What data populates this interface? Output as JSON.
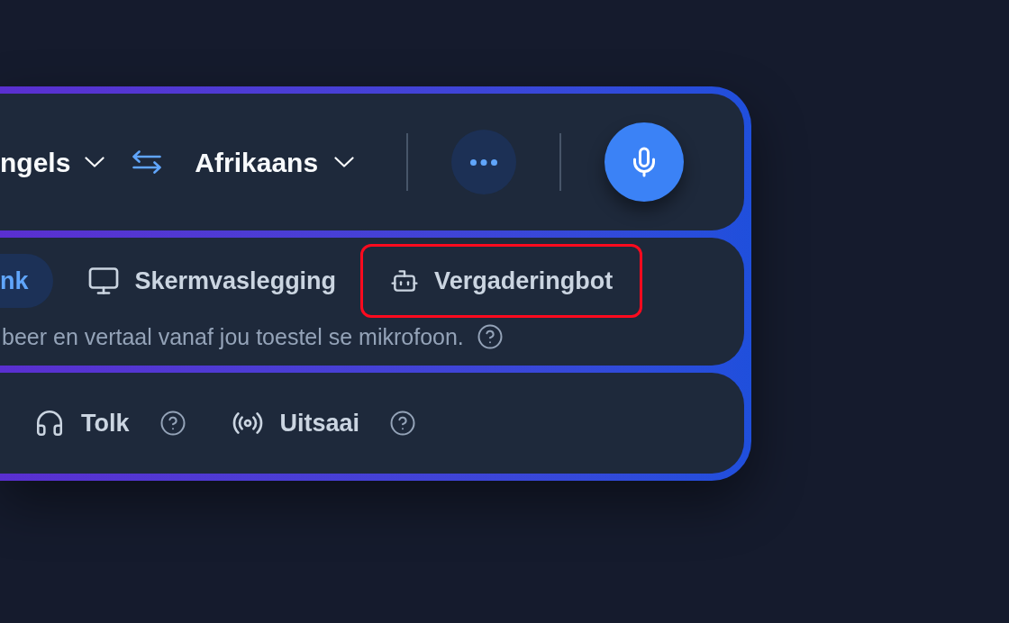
{
  "language_bar": {
    "source_language": "ngels",
    "target_language": "Afrikaans"
  },
  "input_modes": [
    {
      "label": "nk",
      "selected": true,
      "highlighted": false
    },
    {
      "label": "Skermvaslegging",
      "selected": false,
      "highlighted": false
    },
    {
      "label": "Vergaderingbot",
      "selected": false,
      "highlighted": true
    }
  ],
  "input_mode_description": "beer en vertaal vanaf jou toestel se mikrofoon.",
  "output_modes": [
    {
      "label": "Tolk"
    },
    {
      "label": "Uitsaai"
    }
  ]
}
